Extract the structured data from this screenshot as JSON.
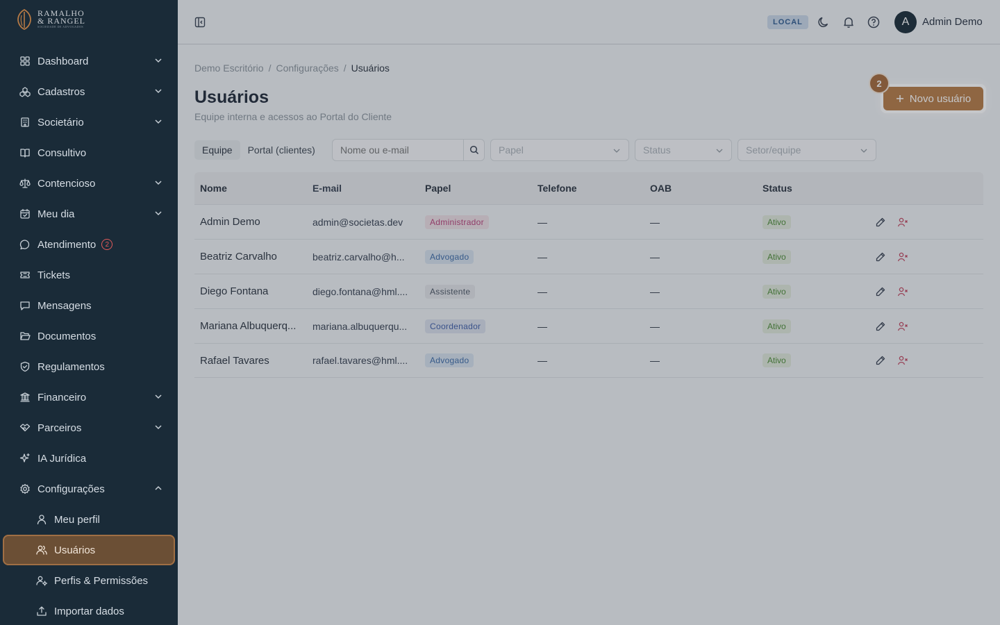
{
  "brand": {
    "line1": "RAMALHO",
    "line2": "& RANGEL",
    "tagline": "SOCIEDADE DE ADVOGADOS"
  },
  "sidebar": {
    "items": [
      {
        "label": "Dashboard",
        "icon": "layout-grid-icon",
        "expandable": true
      },
      {
        "label": "Cadastros",
        "icon": "boxes-icon",
        "expandable": true
      },
      {
        "label": "Societário",
        "icon": "building-icon",
        "expandable": true
      },
      {
        "label": "Consultivo",
        "icon": "book-open-icon",
        "expandable": false
      },
      {
        "label": "Contencioso",
        "icon": "scale-icon",
        "expandable": true
      },
      {
        "label": "Meu dia",
        "icon": "calendar-check-icon",
        "expandable": true
      },
      {
        "label": "Atendimento",
        "icon": "message-circle-icon",
        "expandable": false,
        "badge": "2"
      },
      {
        "label": "Tickets",
        "icon": "ticket-icon",
        "expandable": false
      },
      {
        "label": "Mensagens",
        "icon": "message-square-icon",
        "expandable": false
      },
      {
        "label": "Documentos",
        "icon": "folder-open-icon",
        "expandable": false
      },
      {
        "label": "Regulamentos",
        "icon": "shield-check-icon",
        "expandable": false
      },
      {
        "label": "Financeiro",
        "icon": "landmark-icon",
        "expandable": true
      },
      {
        "label": "Parceiros",
        "icon": "handshake-icon",
        "expandable": true
      },
      {
        "label": "IA Jurídica",
        "icon": "sparkles-icon",
        "expandable": false
      },
      {
        "label": "Configurações",
        "icon": "settings-icon",
        "expandable": true,
        "expanded": true
      }
    ],
    "subitems": [
      {
        "label": "Meu perfil",
        "icon": "user-icon"
      },
      {
        "label": "Usuários",
        "icon": "users-icon",
        "active": true
      },
      {
        "label": "Perfis & Permissões",
        "icon": "user-cog-icon"
      },
      {
        "label": "Importar dados",
        "icon": "upload-icon"
      }
    ]
  },
  "topbar": {
    "env": "LOCAL",
    "avatar_initial": "A",
    "user_name": "Admin Demo"
  },
  "breadcrumb": [
    "Demo Escritório",
    "Configurações",
    "Usuários"
  ],
  "page": {
    "title": "Usuários",
    "subtitle": "Equipe interna e acessos ao Portal do Cliente",
    "new_button": "Novo usuário",
    "step_badge": "2"
  },
  "filters": {
    "tabs": [
      "Equipe",
      "Portal (clientes)"
    ],
    "active_tab": "Equipe",
    "search_placeholder": "Nome ou e-mail",
    "role_placeholder": "Papel",
    "status_placeholder": "Status",
    "team_placeholder": "Setor/equipe"
  },
  "table": {
    "headers": [
      "Nome",
      "E-mail",
      "Papel",
      "Telefone",
      "OAB",
      "Status"
    ],
    "rows": [
      {
        "name": "Admin Demo",
        "email": "admin@societas.dev",
        "role": "Administrador",
        "role_kind": "admin",
        "phone": "—",
        "oab": "—",
        "status": "Ativo"
      },
      {
        "name": "Beatriz Carvalho",
        "email": "beatriz.carvalho@h...",
        "role": "Advogado",
        "role_kind": "adv",
        "phone": "—",
        "oab": "—",
        "status": "Ativo"
      },
      {
        "name": "Diego Fontana",
        "email": "diego.fontana@hml....",
        "role": "Assistente",
        "role_kind": "assist",
        "phone": "—",
        "oab": "—",
        "status": "Ativo"
      },
      {
        "name": "Mariana Albuquerq...",
        "email": "mariana.albuquerqu...",
        "role": "Coordenador",
        "role_kind": "coord",
        "phone": "—",
        "oab": "—",
        "status": "Ativo"
      },
      {
        "name": "Rafael Tavares",
        "email": "rafael.tavares@hml....",
        "role": "Advogado",
        "role_kind": "adv",
        "phone": "—",
        "oab": "—",
        "status": "Ativo"
      }
    ]
  },
  "colors": {
    "accent": "#b67a45",
    "sidebar_bg": "#1a2b38",
    "status_green": "#4b8a35"
  }
}
